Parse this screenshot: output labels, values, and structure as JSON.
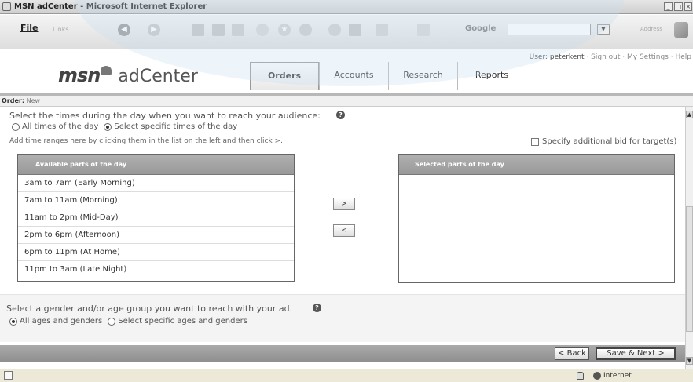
{
  "window": {
    "title": "MSN adCenter - Microsoft Internet Explorer"
  },
  "toolbar": {
    "file_label": "File",
    "links_label": "Links",
    "google_label": "Google",
    "address_label": "Address"
  },
  "header": {
    "brand": "msn",
    "product": "adCenter",
    "user_text": "User: peterkent",
    "sign_out": "Sign out",
    "my_settings": "My Settings",
    "help": "Help",
    "tabs": [
      {
        "label": "Orders"
      },
      {
        "label": "Accounts"
      },
      {
        "label": "Research"
      },
      {
        "label": "Reports"
      }
    ]
  },
  "breadcrumb": {
    "label": "Order:",
    "value": "New"
  },
  "daypart": {
    "question": "Select the times during the day when you want to reach your audience:",
    "option_all": "All times of the day",
    "option_specific": "Select specific times of the day",
    "instruction": "Add time ranges here by clicking them in the list on the left and then click >.",
    "additional_bid": "Specify additional bid for target(s)",
    "available_header": "Available parts of the day",
    "selected_header": "Selected parts of the day",
    "available": [
      "3am to 7am (Early Morning)",
      "7am to 11am (Morning)",
      "11am to 2pm (Mid-Day)",
      "2pm to 6pm (Afternoon)",
      "6pm to 11pm (At Home)",
      "11pm to 3am (Late Night)"
    ],
    "add_label": ">",
    "remove_label": "<"
  },
  "demographic": {
    "question": "Select a gender and/or age group you want to reach with your ad.",
    "option_all": "All ages and genders",
    "option_specific": "Select specific ages and genders"
  },
  "footer": {
    "back_label": "< Back",
    "next_label": "Save & Next >"
  },
  "status": {
    "zone": "Internet"
  }
}
